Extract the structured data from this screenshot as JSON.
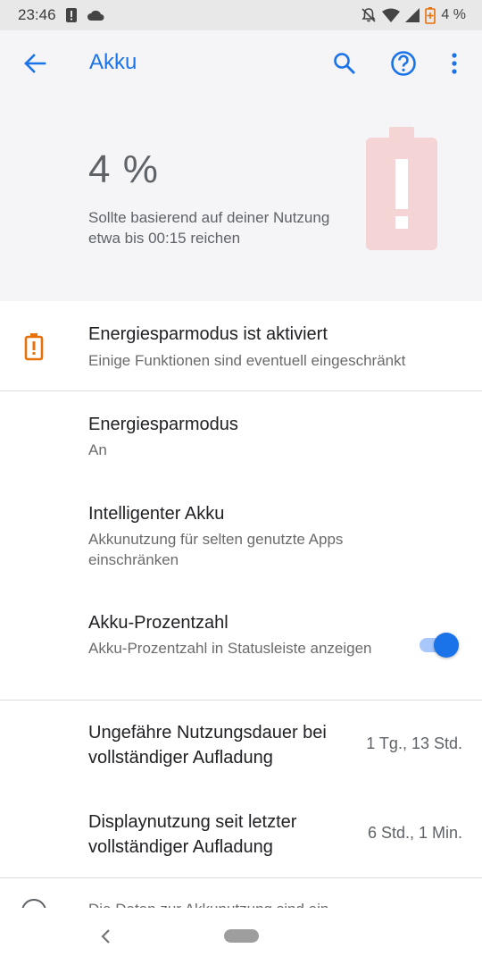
{
  "status_bar": {
    "time": "23:46",
    "battery_text": "4 %"
  },
  "app_bar": {
    "title": "Akku",
    "icons": [
      "back-arrow-icon",
      "search-icon",
      "help-icon",
      "more-vert-icon"
    ],
    "accent_color": "#1a73e8"
  },
  "battery_header": {
    "percent": "4 %",
    "estimate": "Sollte basierend auf deiner Nutzung etwa bis 00:15 reichen",
    "battery_icon": "battery-alert-icon"
  },
  "saver_banner": {
    "title": "Energiesparmodus ist aktiviert",
    "subtitle": "Einige Funktionen sind eventuell eingeschränkt",
    "icon": "battery-saver-alert-icon",
    "icon_color": "#e8710a"
  },
  "settings": {
    "battery_saver": {
      "title": "Energiesparmodus",
      "subtitle": "An"
    },
    "adaptive_battery": {
      "title": "Intelligenter Akku",
      "subtitle": "Akkunutzung für selten genutzte Apps einschränken"
    },
    "battery_percentage": {
      "title": "Akku-Prozentzahl",
      "subtitle": "Akku-Prozentzahl in Statusleiste anzeigen",
      "enabled": true
    }
  },
  "usage": {
    "full_charge_duration": {
      "title": "Ungefähre Nutzungsdauer bei vollständiger Aufladung",
      "value": "1 Tg., 13 Std."
    },
    "screen_usage": {
      "title": "Displaynutzung seit letzter vollständiger Aufladung",
      "value": "6 Std., 1 Min."
    }
  },
  "cutoff": {
    "text": "Die Daten zur Akkunutzung sind ein..."
  }
}
